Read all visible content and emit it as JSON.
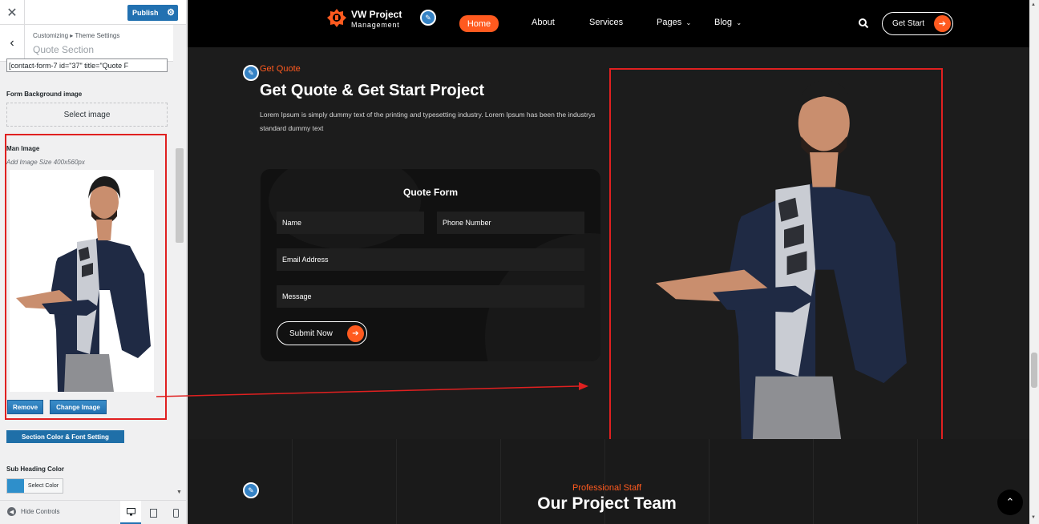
{
  "customizer": {
    "close_icon": "close-icon",
    "publish_label": "Publish",
    "breadcrumb": "Customizing ▸ Theme Settings",
    "section_title": "Quote Section",
    "shortcode_value": "[contact-form-7 id=\"37\" title=\"Quote F",
    "form_bg_label": "Form Background image",
    "select_image_label": "Select image",
    "man_image_label": "Man Image",
    "man_image_note": "Add Image Size 400x560px",
    "remove_label": "Remove",
    "change_image_label": "Change Image",
    "section_color_label": "Section Color & Font Setting",
    "sub_heading_color_label": "Sub Heading Color",
    "select_color_label": "Select Color",
    "sub_heading_color": "#2e8fcb",
    "hide_controls_label": "Hide Controls"
  },
  "site": {
    "logo_line1": "VW Project",
    "logo_line2": "Management",
    "nav": [
      "Home",
      "About",
      "Services",
      "Pages",
      "Blog"
    ],
    "active_nav": "Home",
    "cta_label": "Get Start",
    "accent_color": "#ff5a1f"
  },
  "quote": {
    "sub_heading": "Get Quote",
    "heading": "Get Quote & Get Start Project",
    "paragraph": "Lorem Ipsum is simply dummy text of the printing and typesetting industry. Lorem Ipsum has been the industrys standard dummy text",
    "form_title": "Quote Form",
    "fields": {
      "name": "Name",
      "phone": "Phone Number",
      "email": "Email Address",
      "message": "Message"
    },
    "submit_label": "Submit Now"
  },
  "team": {
    "sub_heading": "Professional Staff",
    "heading": "Our Project Team"
  }
}
